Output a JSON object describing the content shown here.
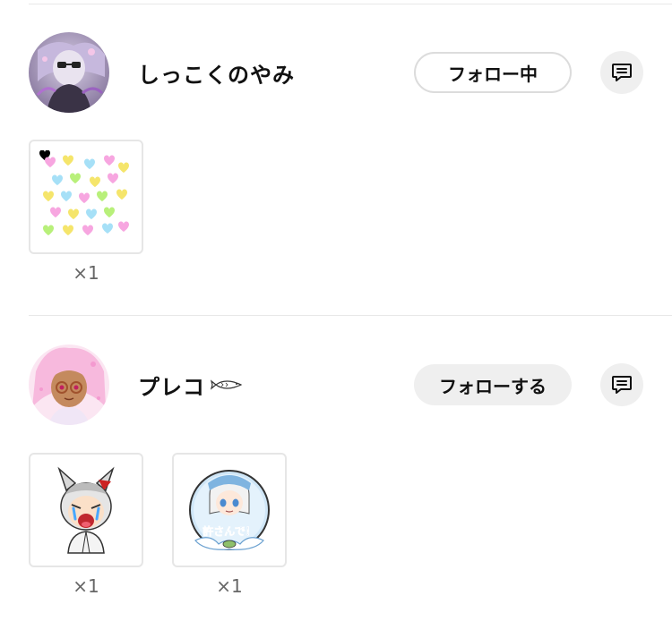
{
  "users": [
    {
      "name": "しっこくのやみ",
      "follow_label": "フォロー中",
      "message_icon": "message-icon",
      "stickers": [
        {
          "icon": "hearts-sticker",
          "count": "×1"
        }
      ]
    },
    {
      "name": "プレコ",
      "name_icon": "fish-icon",
      "follow_label": "フォローする",
      "message_icon": "message-icon",
      "stickers": [
        {
          "icon": "crying-wolf-character-sticker",
          "count": "×1"
        },
        {
          "icon": "forgive-me-character-sticker",
          "sticker_text": "許さんで！",
          "count": "×1"
        }
      ]
    }
  ]
}
